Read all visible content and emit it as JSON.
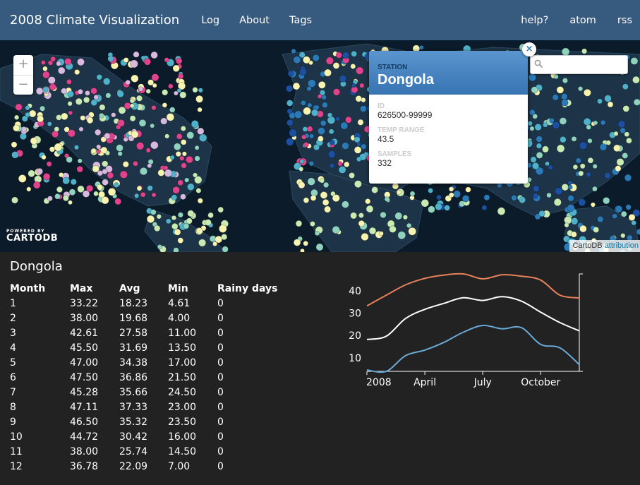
{
  "nav": {
    "brand": "2008 Climate Visualization",
    "left_links": [
      "Log",
      "About",
      "Tags"
    ],
    "right_links": [
      "help?",
      "atom",
      "rss"
    ]
  },
  "map": {
    "zoom_in": "+",
    "zoom_out": "−",
    "search_placeholder": "",
    "logo_small": "POWERED BY",
    "logo_big": "CARTODB",
    "attribution_text": "CartoDB",
    "attribution_link": "attribution",
    "popup": {
      "station_label": "STATION",
      "station_name": "Dongola",
      "id_label": "ID",
      "id_value": "626500-99999",
      "temp_range_label": "TEMP RANGE",
      "temp_range_value": "43.5",
      "samples_label": "SAMPLES",
      "samples_value": "332",
      "close": "×"
    }
  },
  "details": {
    "station_title": "Dongola",
    "columns": [
      "Month",
      "Max",
      "Avg",
      "Min",
      "Rainy days"
    ],
    "rows": [
      [
        "1",
        "33.22",
        "18.23",
        "4.61",
        "0"
      ],
      [
        "2",
        "38.00",
        "19.68",
        "4.00",
        "0"
      ],
      [
        "3",
        "42.61",
        "27.58",
        "11.00",
        "0"
      ],
      [
        "4",
        "45.50",
        "31.69",
        "13.50",
        "0"
      ],
      [
        "5",
        "47.00",
        "34.38",
        "17.00",
        "0"
      ],
      [
        "6",
        "47.50",
        "36.86",
        "21.50",
        "0"
      ],
      [
        "7",
        "45.28",
        "35.66",
        "24.50",
        "0"
      ],
      [
        "8",
        "47.11",
        "37.33",
        "23.00",
        "0"
      ],
      [
        "9",
        "46.50",
        "35.32",
        "23.50",
        "0"
      ],
      [
        "10",
        "44.72",
        "30.42",
        "16.00",
        "0"
      ],
      [
        "11",
        "38.00",
        "25.74",
        "14.50",
        "0"
      ],
      [
        "12",
        "36.78",
        "22.09",
        "7.00",
        "0"
      ]
    ]
  },
  "chart_data": {
    "type": "line",
    "x": [
      1,
      2,
      3,
      4,
      5,
      6,
      7,
      8,
      9,
      10,
      11,
      12
    ],
    "x_tick_labels": [
      "2008",
      "April",
      "July",
      "October"
    ],
    "x_tick_months": [
      1,
      4,
      7,
      10
    ],
    "y_ticks": [
      10,
      20,
      30,
      40
    ],
    "ylim": [
      4,
      47.5
    ],
    "series": [
      {
        "values": [
          33.22,
          38.0,
          42.61,
          45.5,
          47.0,
          47.5,
          45.28,
          47.11,
          46.5,
          44.72,
          38.0,
          36.78
        ],
        "color": "#e8825a"
      },
      {
        "values": [
          18.23,
          19.68,
          27.58,
          31.69,
          34.38,
          36.86,
          35.66,
          37.33,
          35.32,
          30.42,
          25.74,
          22.09
        ],
        "color": "#ffffff"
      },
      {
        "values": [
          4.61,
          4.0,
          11.0,
          13.5,
          17.0,
          21.5,
          24.5,
          23.0,
          23.5,
          16.0,
          14.5,
          7.0
        ],
        "color": "#6aaad8"
      }
    ],
    "grid": false,
    "legend": "none"
  }
}
